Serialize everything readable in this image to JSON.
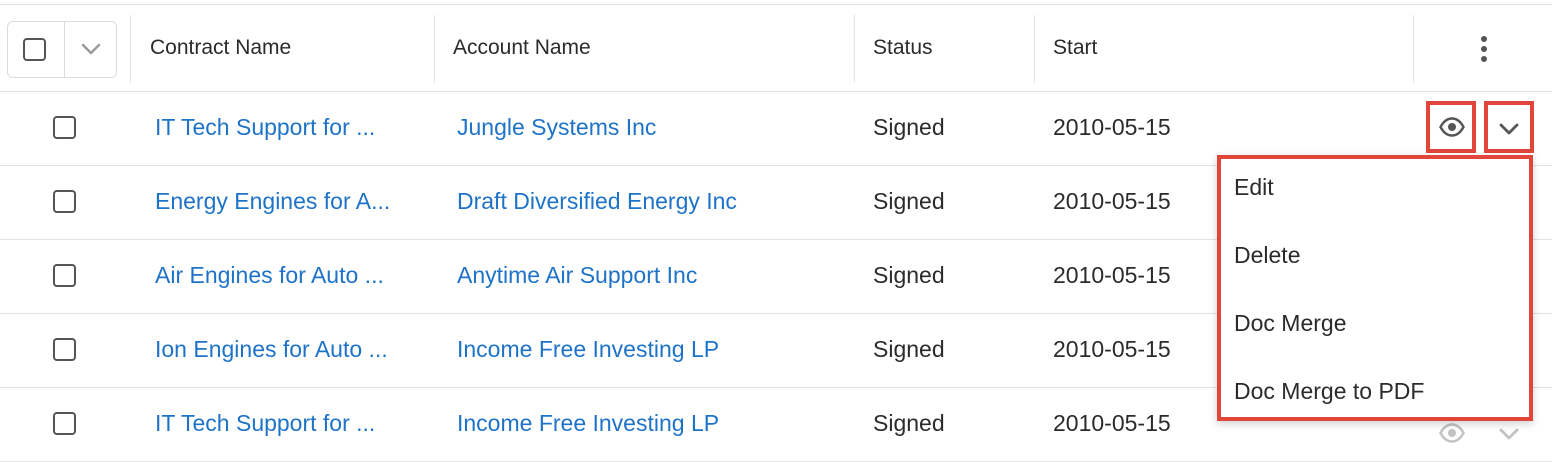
{
  "columns": {
    "contract_name": "Contract Name",
    "account_name": "Account Name",
    "status": "Status",
    "start": "Start"
  },
  "icons": {
    "mass_select_toggle": "chevron-down-icon",
    "column_menu": "kebab-icon",
    "preview": "eye-icon",
    "row_dropdown": "chevron-down-icon"
  },
  "colors": {
    "link": "#1e73c8",
    "highlight": "#e0473a"
  },
  "rows": [
    {
      "contract_name": "IT Tech Support for ...",
      "account_name": "Jungle Systems Inc",
      "status": "Signed",
      "start": "2010-05-15"
    },
    {
      "contract_name": "Energy Engines for A...",
      "account_name": "Draft Diversified Energy Inc",
      "status": "Signed",
      "start": "2010-05-15"
    },
    {
      "contract_name": "Air Engines for Auto ...",
      "account_name": "Anytime Air Support Inc",
      "status": "Signed",
      "start": "2010-05-15"
    },
    {
      "contract_name": "Ion Engines for Auto ...",
      "account_name": "Income Free Investing LP",
      "status": "Signed",
      "start": "2010-05-15"
    },
    {
      "contract_name": "IT Tech Support for ...",
      "account_name": "Income Free Investing LP",
      "status": "Signed",
      "start": "2010-05-15"
    }
  ],
  "row_menu": {
    "items": [
      "Edit",
      "Delete",
      "Doc Merge",
      "Doc Merge to PDF"
    ]
  }
}
